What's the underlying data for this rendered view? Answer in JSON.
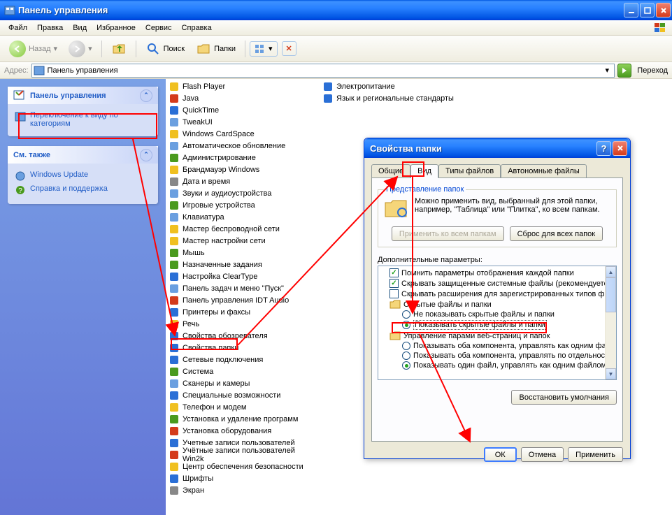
{
  "window": {
    "title": "Панель управления",
    "menus": [
      "Файл",
      "Правка",
      "Вид",
      "Избранное",
      "Сервис",
      "Справка"
    ],
    "toolbar": {
      "back": "Назад",
      "search": "Поиск",
      "folders": "Папки"
    },
    "addressbar": {
      "label": "Адрес:",
      "value": "Панель управления",
      "go": "Переход"
    }
  },
  "sidebar": {
    "panel_title": "Панель управления",
    "switch_view": "Переключение к виду по категориям",
    "see_also_title": "См. также",
    "see_also": [
      "Windows Update",
      "Справка и поддержка"
    ]
  },
  "cp_items_col1": [
    "Flash Player",
    "Java",
    "QuickTime",
    "TweakUI",
    "Windows CardSpace",
    "Автоматическое обновление",
    "Администрирование",
    "Брандмауэр Windows",
    "Дата и время",
    "Звуки и аудиоустройства",
    "Игровые устройства",
    "Клавиатура",
    "Мастер беспроводной сети",
    "Мастер настройки сети",
    "Мышь",
    "Назначенные задания",
    "Настройка ClearType",
    "Панель задач и меню \"Пуск\"",
    "Панель управления IDT Audio",
    "Принтеры и факсы",
    "Речь",
    "Свойства обозревателя",
    "Свойства папки",
    "Сетевые подключения",
    "Система",
    "Сканеры и камеры",
    "Специальные возможности",
    "Телефон и модем",
    "Установка и удаление программ",
    "Установка оборудования",
    "Учетные записи пользователей",
    "Учётные записи пользователей Win2k",
    "Центр обеспечения безопасности",
    "Шрифты",
    "Экран"
  ],
  "cp_items_col2": [
    "Электропитание",
    "Язык и региональные стандарты"
  ],
  "dialog": {
    "title": "Свойства папки",
    "tabs": [
      "Общие",
      "Вид",
      "Типы файлов",
      "Автономные файлы"
    ],
    "group_label": "Представление папок",
    "group_text": "Можно применить вид, выбранный для этой папки, например, \"Таблица\" или \"Плитка\", ко всем папкам.",
    "apply_all": "Применить ко всем папкам",
    "reset_all": "Сброс для всех папок",
    "adv_label": "Дополнительные параметры:",
    "tree": {
      "n1": "Помнить параметры отображения каждой папки",
      "n2": "Скрывать защищенные системные файлы (рекомендуется",
      "n3": "Скрывать расширения для зарегистрированных типов фа",
      "n4": "Скрытые файлы и папки",
      "n5": "Не показывать скрытые файлы и папки",
      "n6": "Показывать скрытые файлы и папки",
      "n7": "Управление парами веб-страниц и папок",
      "n8": "Показывать оба компонента, управлять как одним фа",
      "n9": "Показывать оба компонента, управлять по отдельнос",
      "n10": "Показывать один файл, управлять как одним файлом"
    },
    "restore": "Восстановить умолчания",
    "ok": "ОК",
    "cancel": "Отмена",
    "apply": "Применить"
  }
}
